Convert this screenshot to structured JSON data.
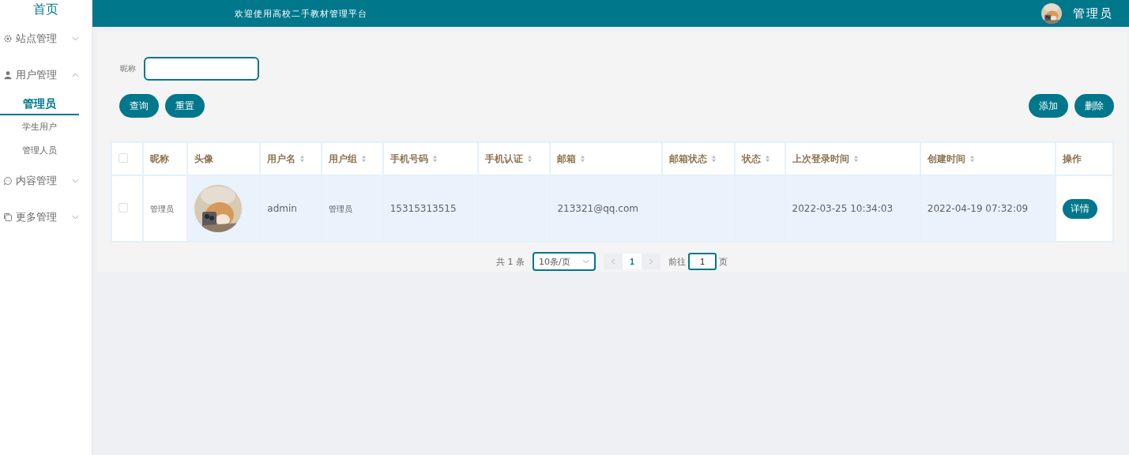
{
  "sidebar": {
    "title": "首页",
    "items": [
      {
        "label": "站点管理",
        "expanded": false
      },
      {
        "label": "用户管理",
        "expanded": true,
        "children": [
          {
            "label": "管理员",
            "selected": true
          },
          {
            "label": "学生用户",
            "selected": false
          },
          {
            "label": "管理人员",
            "selected": false
          }
        ]
      },
      {
        "label": "内容管理",
        "expanded": false
      },
      {
        "label": "更多管理",
        "expanded": false
      }
    ]
  },
  "header": {
    "title": "欢迎使用高校二手教材管理平台",
    "user": "管理员"
  },
  "search": {
    "label": "昵称"
  },
  "buttons": {
    "left": [
      "查询",
      "重置"
    ],
    "right": [
      "添加",
      "删除"
    ]
  },
  "table": {
    "all_checked": false,
    "columns": [
      {
        "label": "昵称",
        "sortable": false
      },
      {
        "label": "头像",
        "sortable": false
      },
      {
        "label": "用户名",
        "sortable": true
      },
      {
        "label": "用户组",
        "sortable": true
      },
      {
        "label": "手机号码",
        "sortable": true
      },
      {
        "label": "手机认证",
        "sortable": true
      },
      {
        "label": "邮箱",
        "sortable": true
      },
      {
        "label": "邮箱状态",
        "sortable": true
      },
      {
        "label": "状态",
        "sortable": true
      },
      {
        "label": "上次登录时间",
        "sortable": true
      },
      {
        "label": "创建时间",
        "sortable": true
      },
      {
        "label": "操作",
        "sortable": false
      }
    ],
    "rows": [
      {
        "checked": false,
        "nickname": "管理员",
        "username": "admin",
        "group": "管理员",
        "phone": "15315313515",
        "email": "213321@qq.com",
        "last_login": "2022-03-25 10:34:03",
        "created": "2022-04-19 07:32:09",
        "action": "详情"
      }
    ]
  },
  "pagination": {
    "total": "共 1 条",
    "page_size": "10条/页",
    "pages": [
      {
        "label": "1",
        "selected": true
      }
    ],
    "goto_label": "前往",
    "goto_value": "1",
    "goto_suffix": "页"
  }
}
